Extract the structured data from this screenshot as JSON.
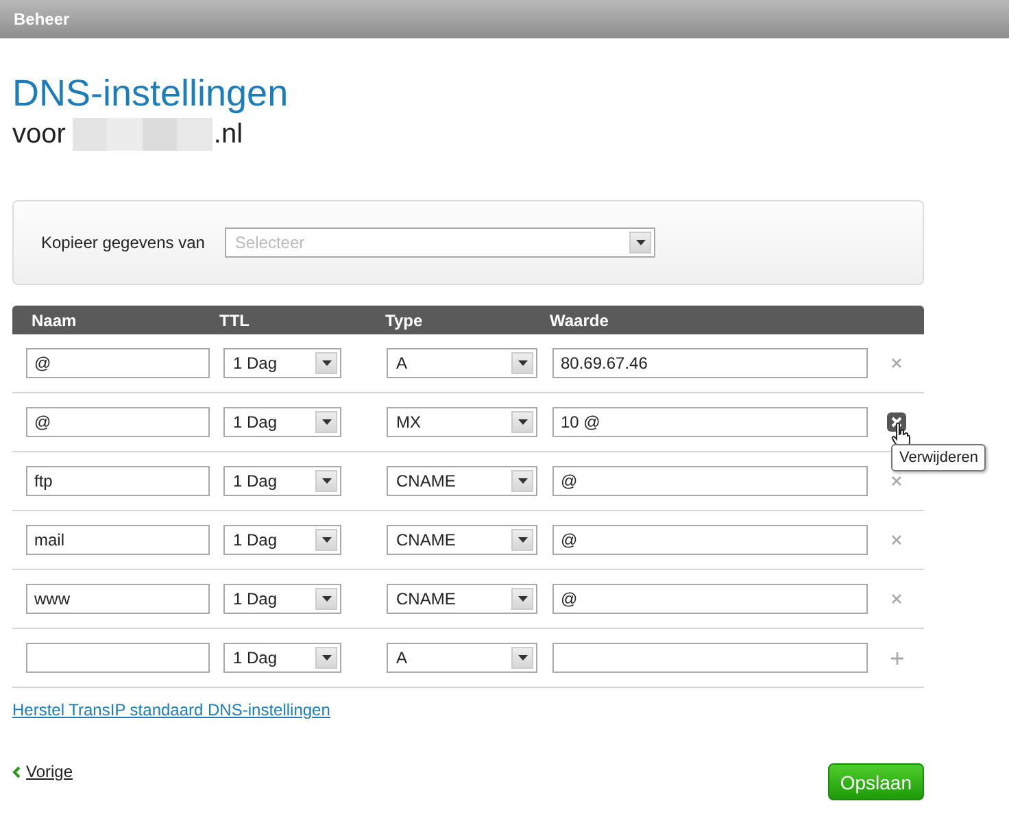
{
  "topbar": {
    "title": "Beheer"
  },
  "heading": "DNS-instellingen",
  "subheading": {
    "prefix": "voor",
    "suffix": ".nl"
  },
  "copy": {
    "label": "Kopieer gegevens van",
    "placeholder": "Selecteer"
  },
  "table": {
    "columns": [
      "Naam",
      "TTL",
      "Type",
      "Waarde"
    ],
    "rows": [
      {
        "name": "@",
        "ttl": "1 Dag",
        "type": "A",
        "value": "80.69.67.46",
        "kind": "remove",
        "hovered": false
      },
      {
        "name": "@",
        "ttl": "1 Dag",
        "type": "MX",
        "value": "10 @",
        "kind": "remove",
        "hovered": true
      },
      {
        "name": "ftp",
        "ttl": "1 Dag",
        "type": "CNAME",
        "value": "@",
        "kind": "remove",
        "hovered": false
      },
      {
        "name": "mail",
        "ttl": "1 Dag",
        "type": "CNAME",
        "value": "@",
        "kind": "remove",
        "hovered": false
      },
      {
        "name": "www",
        "ttl": "1 Dag",
        "type": "CNAME",
        "value": "@",
        "kind": "remove",
        "hovered": false
      },
      {
        "name": "",
        "ttl": "1 Dag",
        "type": "A",
        "value": "",
        "kind": "add",
        "hovered": false
      }
    ]
  },
  "tooltip": "Verwijderen",
  "reset_link": "Herstel TransIP standaard DNS-instellingen",
  "back_link": "Vorige",
  "save_button": "Opslaan"
}
